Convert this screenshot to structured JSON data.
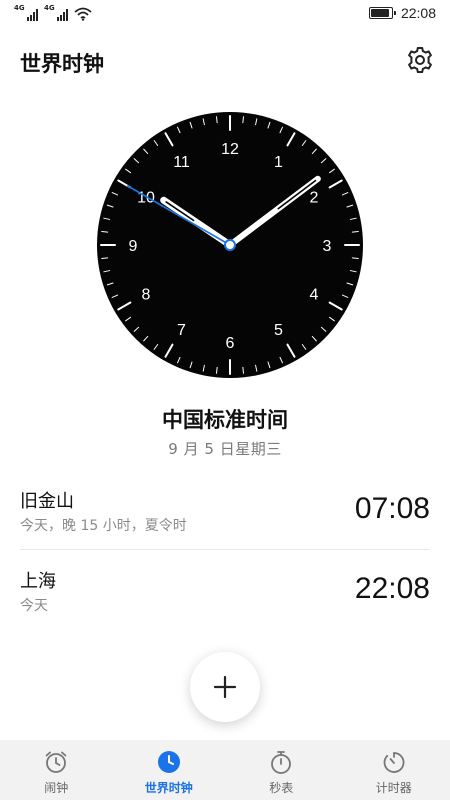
{
  "status_bar": {
    "signal1_tag": "4G",
    "signal2_tag": "4G",
    "time": "22:08",
    "battery_level": 0.9
  },
  "header": {
    "title": "世界时钟",
    "settings_icon": "gear-icon"
  },
  "clock": {
    "numerals": [
      "12",
      "1",
      "2",
      "3",
      "4",
      "5",
      "6",
      "7",
      "8",
      "9",
      "10",
      "11"
    ],
    "hour": 22,
    "minute": 8,
    "second": 50,
    "second_hand_color": "#1a73e8"
  },
  "home_zone": {
    "name": "中国标准时间",
    "date": "9 月 5 日星期三"
  },
  "cities": [
    {
      "name": "旧金山",
      "desc": "今天，晚 15 小时，夏令时",
      "time": "07:08"
    },
    {
      "name": "上海",
      "desc": "今天",
      "time": "22:08"
    }
  ],
  "fab": {
    "icon": "plus-icon"
  },
  "nav": {
    "active_color": "#1a73e8",
    "items": [
      {
        "label": "闹钟",
        "icon": "alarm-icon",
        "active": false
      },
      {
        "label": "世界时钟",
        "icon": "world-clock-icon",
        "active": true
      },
      {
        "label": "秒表",
        "icon": "stopwatch-icon",
        "active": false
      },
      {
        "label": "计时器",
        "icon": "timer-icon",
        "active": false
      }
    ]
  }
}
